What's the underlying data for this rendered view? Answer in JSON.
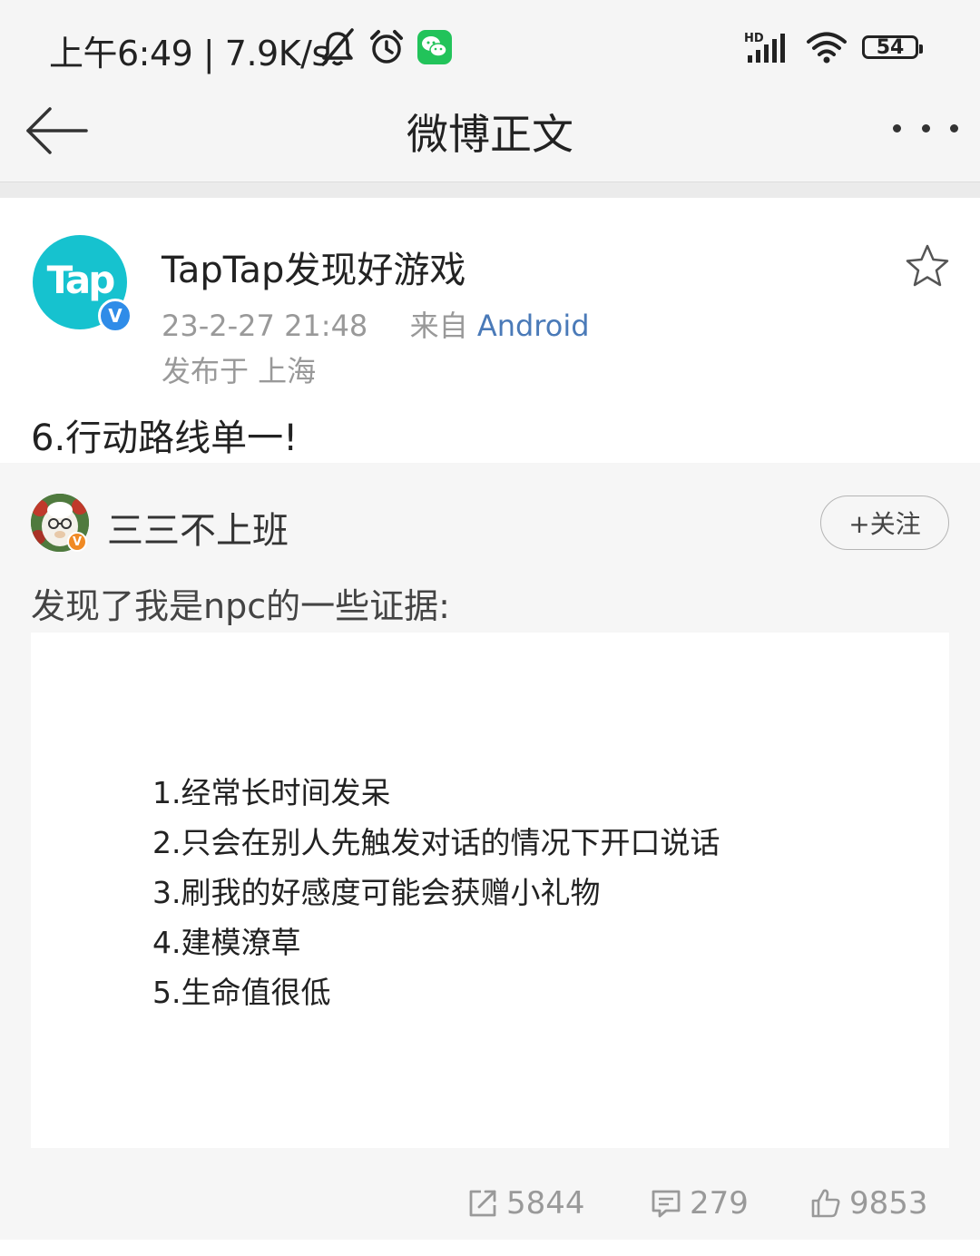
{
  "status_bar": {
    "time_speed": "上午6:49 | 7.9K/s",
    "battery": "54",
    "icons": [
      "mute-bell-icon",
      "alarm-icon",
      "wechat-icon",
      "hd-signal-icon",
      "wifi-icon",
      "battery-icon"
    ]
  },
  "nav": {
    "title": "微博正文",
    "back_icon": "arrow-left-icon",
    "more_icon": "more-icon"
  },
  "post": {
    "avatar_text": "Tap",
    "verified_mark": "V",
    "author": "TapTap发现好游戏",
    "date": "23-2-27 21:48",
    "from_label": "来自",
    "source": "Android",
    "location": "发布于 上海",
    "text": "6.行动路线单一!"
  },
  "retweet": {
    "author": "三三不上班",
    "verified_mark": "V",
    "follow_label": "+关注",
    "text": "发现了我是npc的一些证据:",
    "image_lines": [
      "1.经常长时间发呆",
      "2.只会在别人先触发对话的情况下开口说话",
      "3.刷我的好感度可能会获赠小礼物",
      "4.建模潦草",
      "5.生命值很低"
    ]
  },
  "actions": {
    "repost_count": "5844",
    "comment_count": "279",
    "like_count": "9853"
  },
  "colors": {
    "background": "#f5f5f5",
    "card": "#ffffff",
    "link_blue": "#4a7ab8",
    "tap_teal": "#16c2cf",
    "verify_blue": "#2f8ce8",
    "verify_orange": "#f08a24"
  }
}
